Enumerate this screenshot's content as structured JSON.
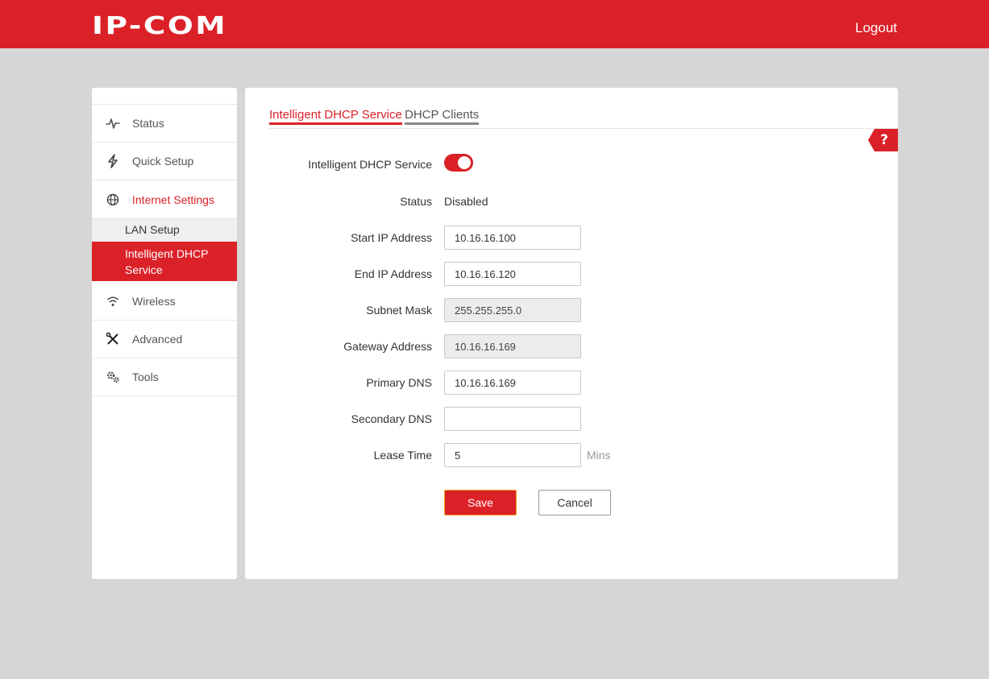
{
  "header": {
    "logo_text": "IP-COM",
    "logout_label": "Logout",
    "brand_color": "#db2128"
  },
  "sidebar": {
    "items": [
      {
        "label": "Status",
        "icon": "pulse-icon"
      },
      {
        "label": "Quick Setup",
        "icon": "lightning-icon"
      },
      {
        "label": "Internet Settings",
        "icon": "globe-icon",
        "active": true
      },
      {
        "label": "Wireless",
        "icon": "wifi-icon"
      },
      {
        "label": "Advanced",
        "icon": "tools-icon"
      },
      {
        "label": "Tools",
        "icon": "gears-icon"
      }
    ],
    "subitems": [
      {
        "label": "LAN Setup"
      },
      {
        "label_line1": "Intelligent DHCP",
        "label_line2": "Service",
        "active": true
      }
    ]
  },
  "main": {
    "tabs": [
      {
        "label": "Intelligent DHCP Service",
        "active": true
      },
      {
        "label": "DHCP Clients",
        "active": false
      }
    ],
    "help_icon": "help-question-icon",
    "help_label": "?",
    "form": {
      "service_label": "Intelligent DHCP Service",
      "service_enabled": true,
      "status_label": "Status",
      "status_value": "Disabled",
      "start_ip_label": "Start IP Address",
      "start_ip_value": "10.16.16.100",
      "end_ip_label": "End IP Address",
      "end_ip_value": "10.16.16.120",
      "subnet_label": "Subnet Mask",
      "subnet_value": "255.255.255.0",
      "gateway_label": "Gateway Address",
      "gateway_value": "10.16.16.169",
      "primary_dns_label": "Primary DNS",
      "primary_dns_value": "10.16.16.169",
      "secondary_dns_label": "Secondary DNS",
      "secondary_dns_value": "",
      "lease_label": "Lease Time",
      "lease_value": "5",
      "lease_unit": "Mins"
    },
    "save_label": "Save",
    "cancel_label": "Cancel"
  }
}
